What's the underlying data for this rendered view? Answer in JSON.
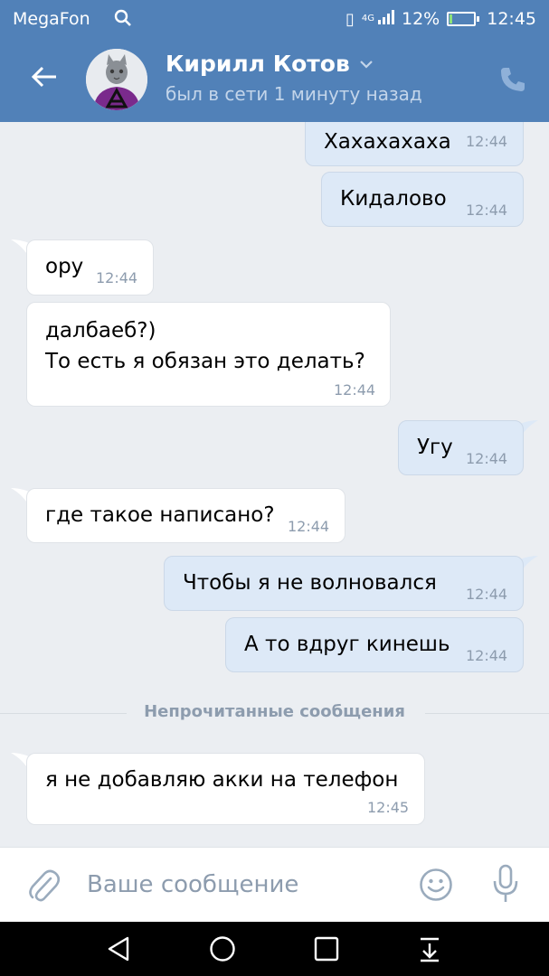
{
  "status_bar": {
    "carrier": "MegaFon",
    "network": "4G",
    "battery": "12%",
    "time": "12:45"
  },
  "header": {
    "name": "Кирилл Котов",
    "last_seen": "был в сети 1 минуту назад"
  },
  "messages": [
    {
      "direction": "out",
      "text": "Хахахахаха",
      "time": "12:44"
    },
    {
      "direction": "out",
      "text": "Кидалово",
      "time": "12:44"
    },
    {
      "direction": "in",
      "text": "ору",
      "time": "12:44"
    },
    {
      "direction": "in",
      "text": "далбаеб?)\nТо есть я обязан это делать?",
      "time": "12:44"
    },
    {
      "direction": "out",
      "text": "Угу",
      "time": "12:44"
    },
    {
      "direction": "in",
      "text": "где такое написано?",
      "time": "12:44"
    },
    {
      "direction": "out",
      "text": "Чтобы я не волновался",
      "time": "12:44"
    },
    {
      "direction": "out",
      "text": "А то вдруг кинешь",
      "time": "12:44"
    },
    {
      "direction": "in",
      "text": "я не добавляю акки на телефон",
      "time": "12:45"
    }
  ],
  "unread_divider": "Непрочитанные сообщения",
  "composer": {
    "placeholder": "Ваше сообщение"
  },
  "colors": {
    "header": "#5181b8",
    "background": "#ebeef2",
    "incoming_bubble": "#ffffff",
    "outgoing_bubble": "#dde9f7"
  }
}
